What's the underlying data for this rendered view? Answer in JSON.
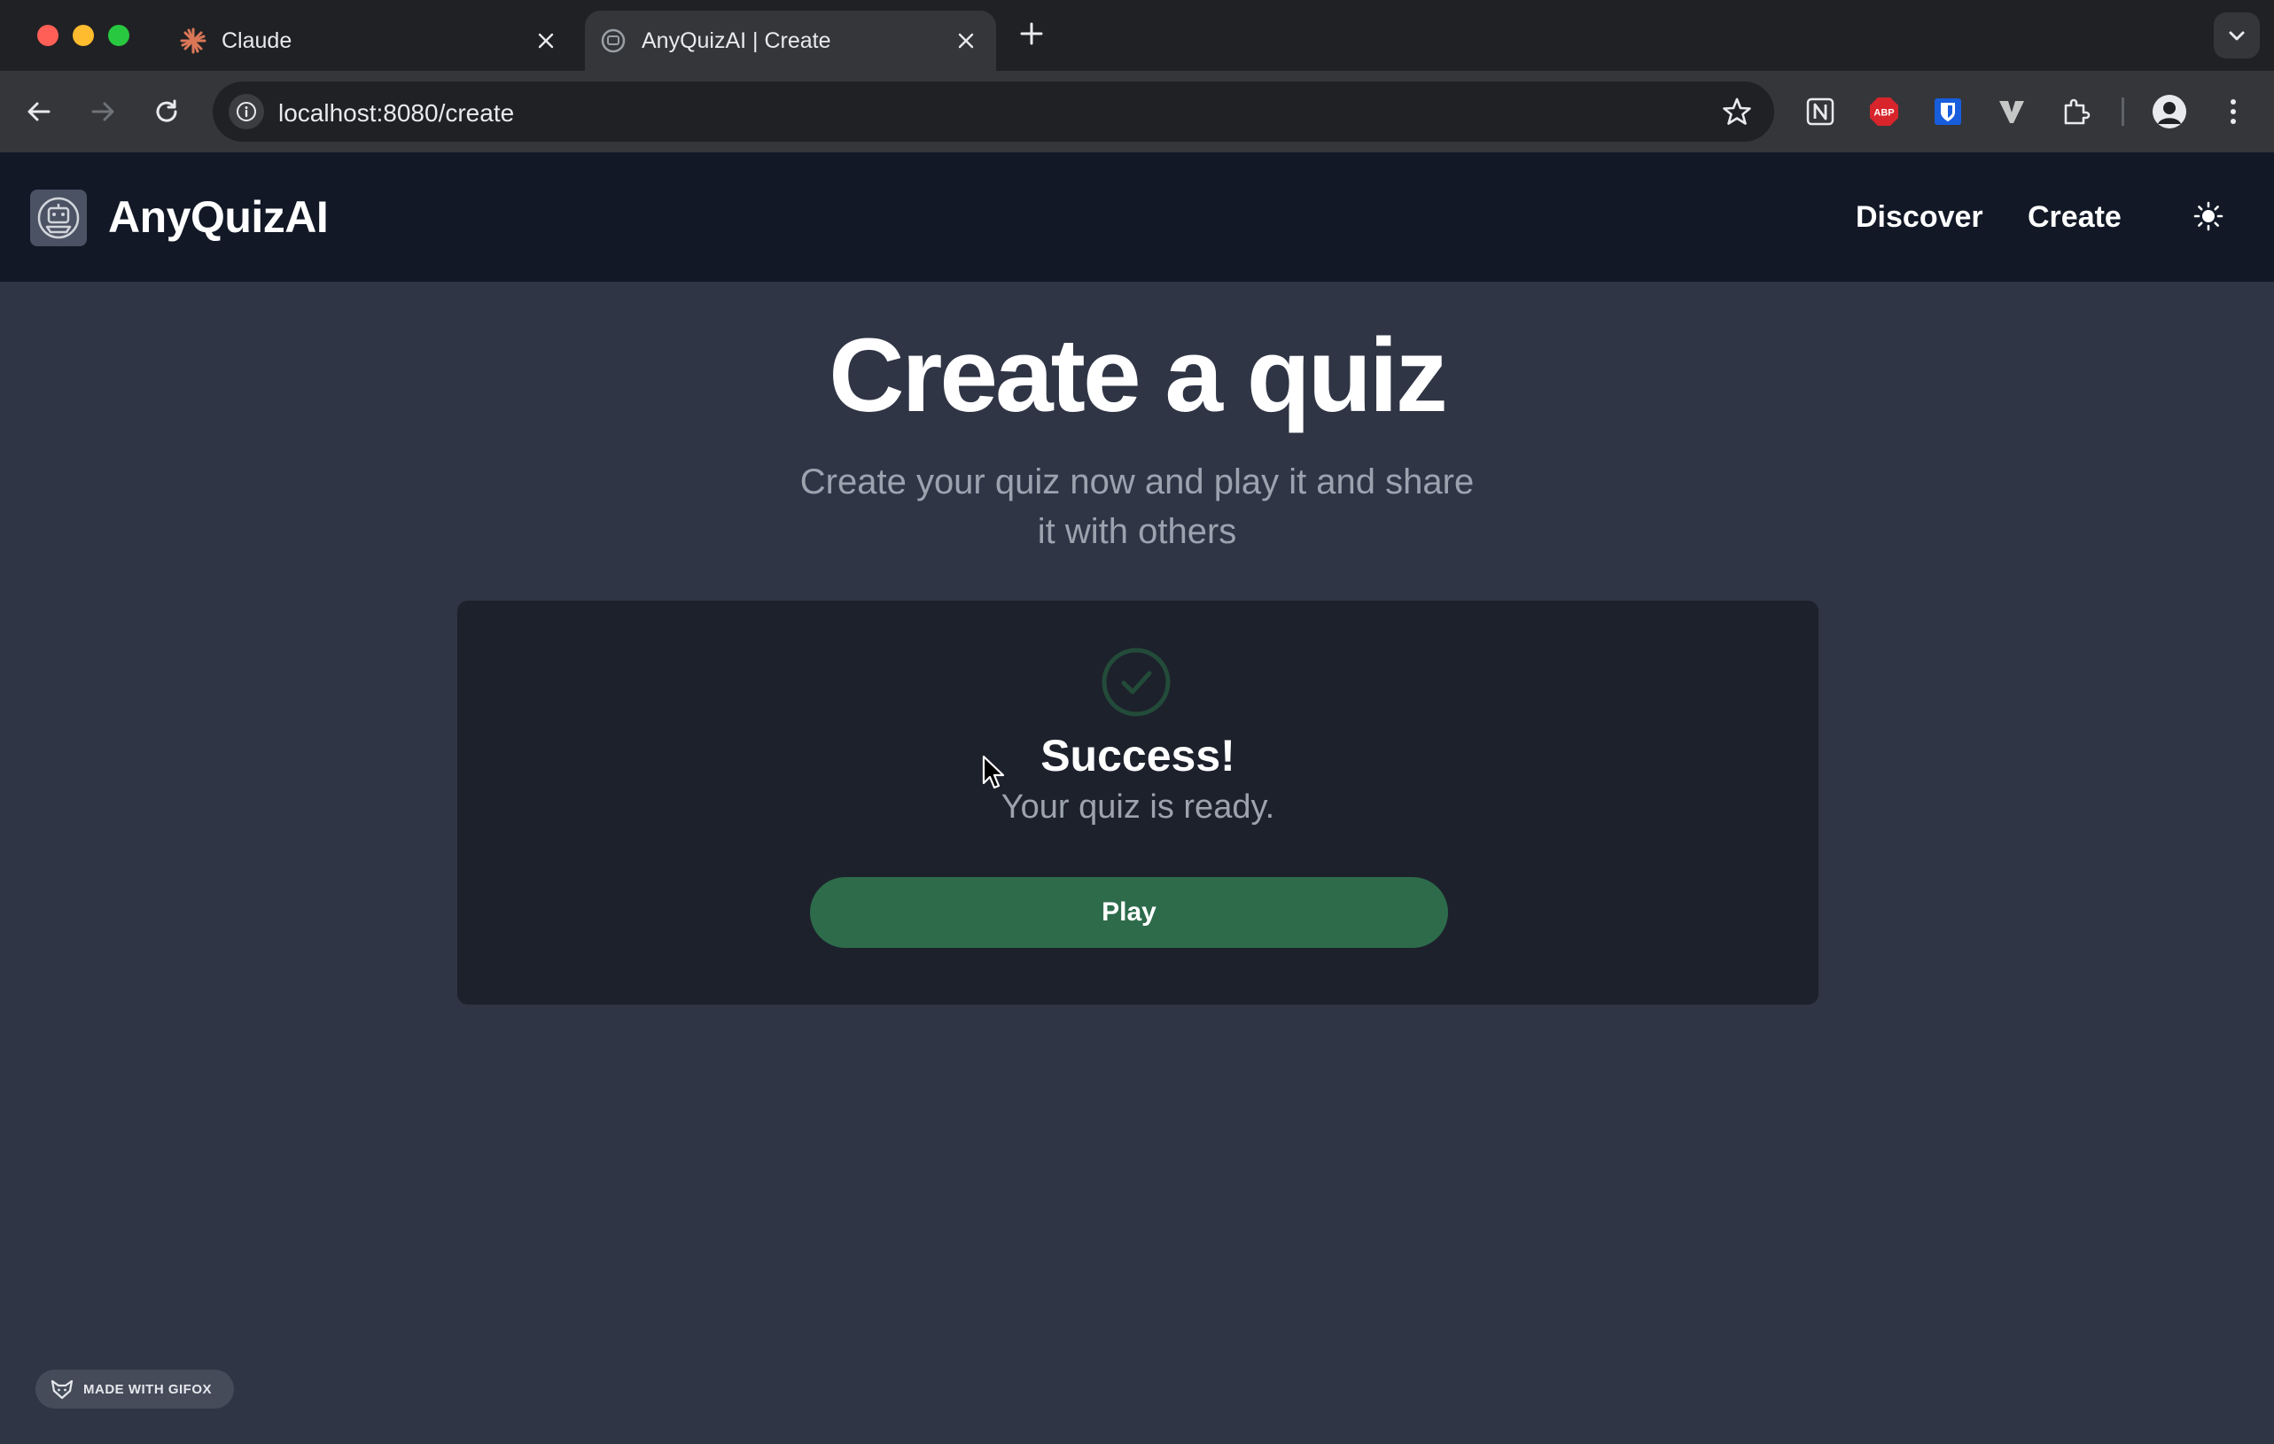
{
  "browser": {
    "tabs": [
      {
        "title": "Claude",
        "icon": "claude-asterisk-icon",
        "active": false
      },
      {
        "title": "AnyQuizAI | Create",
        "icon": "anyquizai-favicon",
        "active": true
      }
    ],
    "address": "localhost:8080/create",
    "extensions": [
      "notion-icon",
      "adblock-plus-icon",
      "bitwarden-icon",
      "vimium-icon",
      "extensions-puzzle-icon"
    ]
  },
  "header": {
    "brand": "AnyQuizAI",
    "nav": {
      "discover": "Discover",
      "create": "Create"
    },
    "theme_icon": "sun-icon"
  },
  "main": {
    "title": "Create a quiz",
    "subtitle_line1": "Create your quiz now and play it and share",
    "subtitle_line2": "it with others"
  },
  "card": {
    "status_icon": "check-circle-icon",
    "title": "Success!",
    "message": "Your quiz is ready.",
    "button_label": "Play"
  },
  "watermark": {
    "label": "MADE WITH GIFOX"
  },
  "colors": {
    "page_bg": "#2f3545",
    "header_bg": "#121826",
    "card_bg": "#1d212c",
    "accent_green": "#2d6b4b",
    "muted_text": "#9ca3af"
  }
}
